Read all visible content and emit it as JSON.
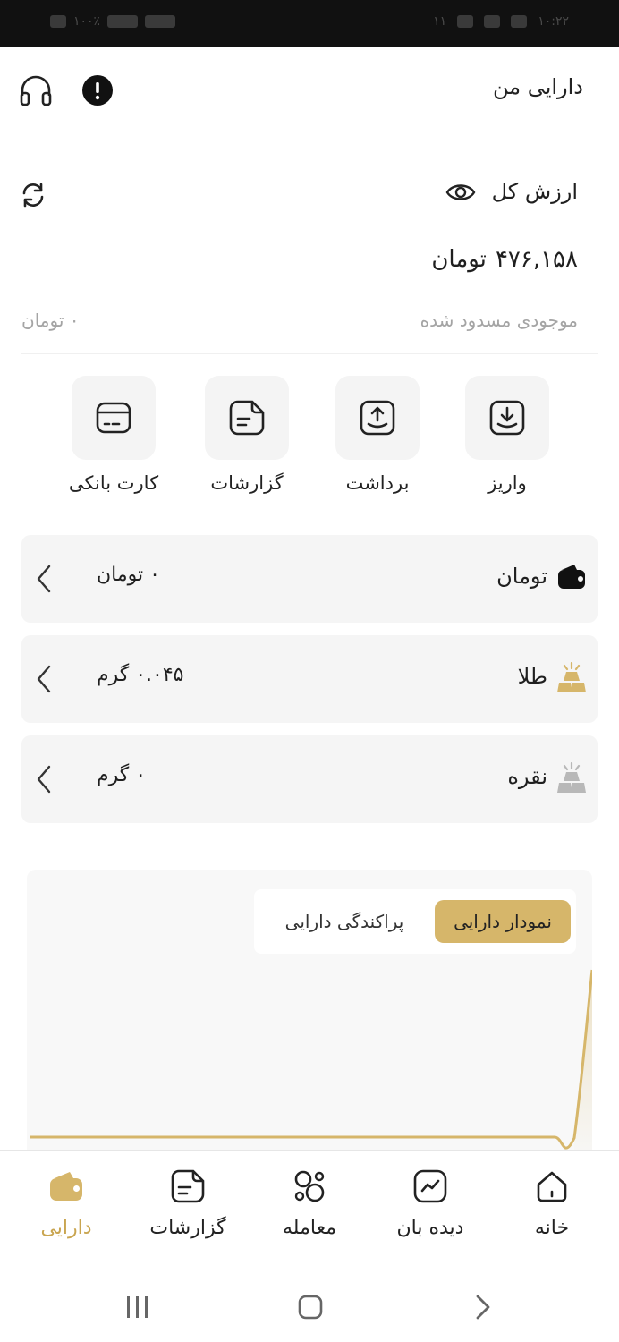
{
  "status_bar": {
    "time": "۱۰:۲۲",
    "notifications": "۱۱",
    "battery": "۱۰۰٪"
  },
  "header": {
    "title": "دارایی من"
  },
  "summary": {
    "total_label": "ارزش کل",
    "total_amount": "۴۷۶,۱۵۸",
    "total_unit": "تومان",
    "blocked_label": "موجودی مسدود شده",
    "blocked_value": "۰ تومان"
  },
  "actions": [
    {
      "label": "واریز",
      "icon": "deposit-icon"
    },
    {
      "label": "برداشت",
      "icon": "withdraw-icon"
    },
    {
      "label": "گزارشات",
      "icon": "reports-icon"
    },
    {
      "label": "کارت بانکی",
      "icon": "bank-card-icon"
    }
  ],
  "assets": [
    {
      "name": "تومان",
      "amount": "۰ تومان",
      "icon": "wallet-icon"
    },
    {
      "name": "طلا",
      "amount": "۰.۰۴۵ گرم",
      "icon": "gold-bars-icon"
    },
    {
      "name": "نقره",
      "amount": "۰ گرم",
      "icon": "silver-bars-icon"
    }
  ],
  "chart_tabs": {
    "active": "نمودار دارایی",
    "inactive": "پراکندگی دارایی"
  },
  "bottom_nav": [
    {
      "label": "خانه",
      "icon": "home-icon"
    },
    {
      "label": "دیده بان",
      "icon": "watchlist-icon"
    },
    {
      "label": "معامله",
      "icon": "trade-icon"
    },
    {
      "label": "گزارشات",
      "icon": "reports-icon"
    },
    {
      "label": "دارایی",
      "icon": "wallet-icon",
      "active": true
    }
  ],
  "colors": {
    "accent": "#d6b66a",
    "active_nav": "#c9a550",
    "muted": "#a4a4a4",
    "silver": "#b8b8b8"
  }
}
